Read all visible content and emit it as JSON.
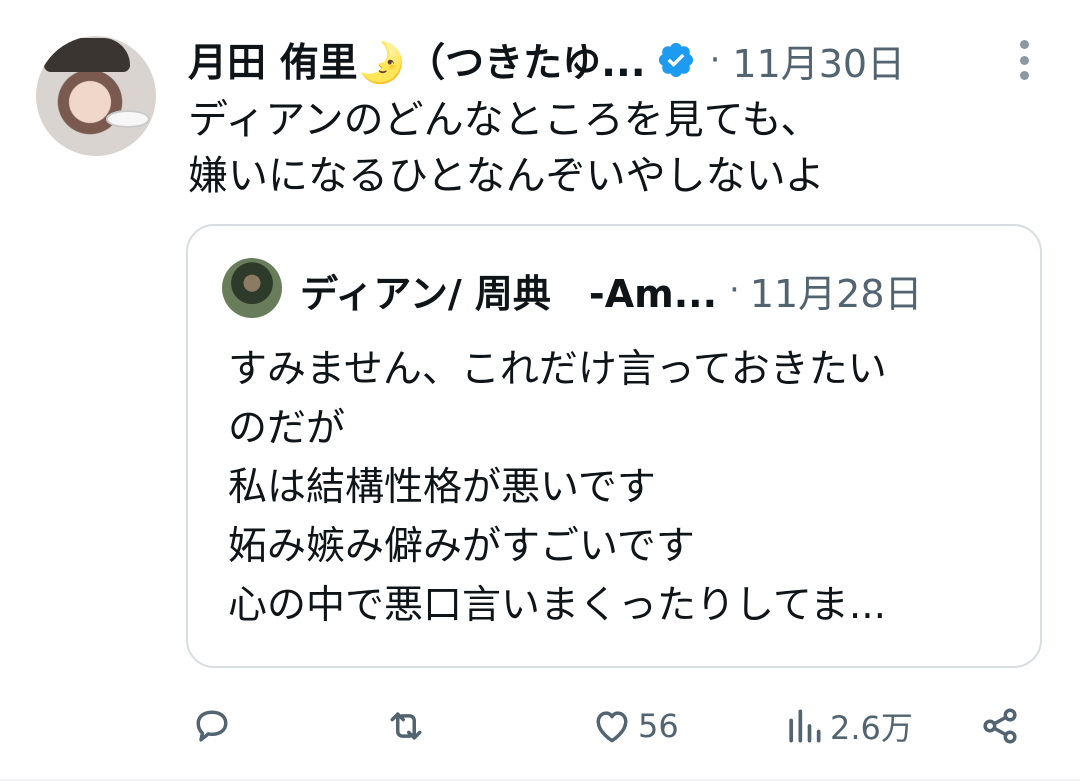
{
  "tweet": {
    "author_name": "月田 侑里🌛（つきたゆ...",
    "dot": "·",
    "date": "11月30日",
    "text_lines": [
      "ディアンのどんなところを見ても、",
      "嫌いになるひとなんぞいやしないよ"
    ]
  },
  "quote": {
    "author_name": "ディアン/ 周典　-Am...",
    "dot": "·",
    "date": "11月28日",
    "text_lines": [
      "すみません、これだけ言っておきたい",
      "のだが",
      "私は結構性格が悪いです",
      "妬み嫉み僻みがすごいです",
      "心の中で悪口言いまくったりしてま..."
    ]
  },
  "actions": {
    "like_count": "56",
    "views_count": "2.6万"
  },
  "icons": {
    "verified": "verified-badge-icon",
    "more": "more-vertical-icon",
    "reply": "reply-icon",
    "retweet": "retweet-icon",
    "like": "heart-icon",
    "views": "views-bar-icon",
    "share": "share-icon"
  },
  "colors": {
    "accent": "#1d9bf0",
    "muted": "#536471",
    "text": "#0f1419"
  }
}
